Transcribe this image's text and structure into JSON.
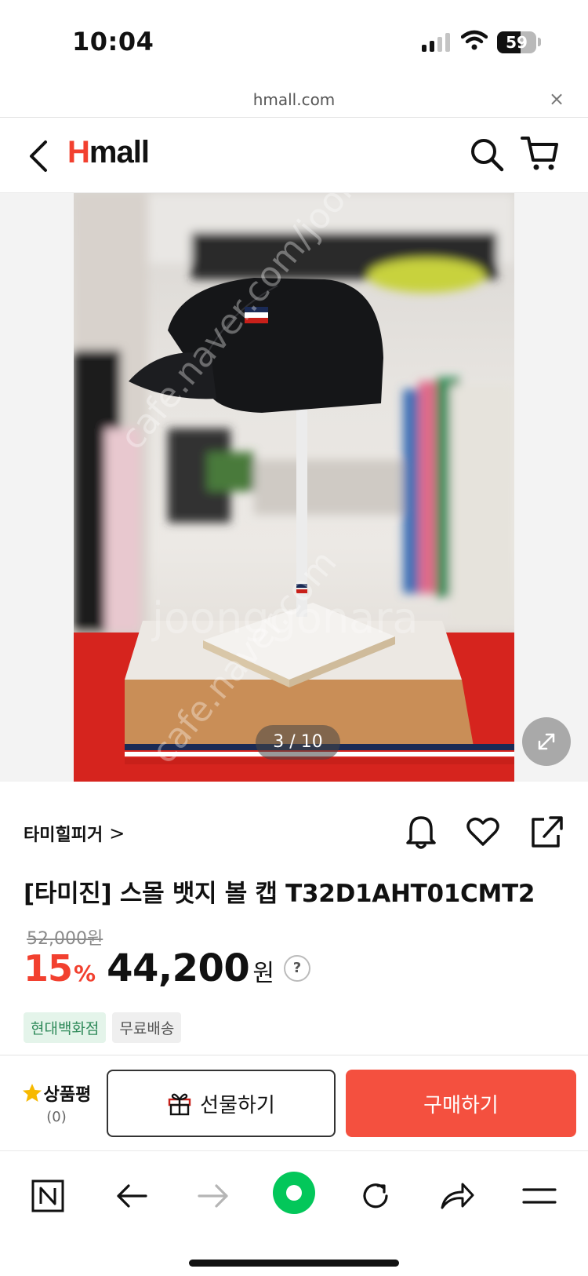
{
  "status_bar": {
    "time": "10:04",
    "battery_level": "59"
  },
  "browser": {
    "url": "hmall.com",
    "close_glyph": "×"
  },
  "header": {
    "logo_h": "H",
    "logo_rest": "mall"
  },
  "gallery": {
    "counter": "3 / 10"
  },
  "product": {
    "brand": "타미힐피거",
    "brand_chevron": ">",
    "title": "[타미진] 스몰 뱃지 볼 캡 T32D1AHT01CMT2",
    "original_price": "52,000원",
    "discount": "15",
    "discount_unit": "%",
    "price": "44,200",
    "currency": "원",
    "help": "?",
    "tags": [
      "현대백화점",
      "무료배송"
    ]
  },
  "buy_bar": {
    "review_label": "상품평",
    "review_count": "(0)",
    "gift_label": "선물하기",
    "buy_label": "구매하기"
  },
  "colors": {
    "accent": "#f2402f",
    "buy_button": "#f4503f",
    "naver_green": "#03c75a"
  },
  "icons": [
    "back-icon",
    "search-icon",
    "cart-icon",
    "expand-icon",
    "bell-icon",
    "heart-icon",
    "share-icon",
    "star-icon",
    "gift-icon",
    "naver-n-icon",
    "arrow-back-icon",
    "arrow-forward-icon",
    "green-dot-icon",
    "refresh-icon",
    "share-arrow-icon",
    "menu-icon"
  ]
}
